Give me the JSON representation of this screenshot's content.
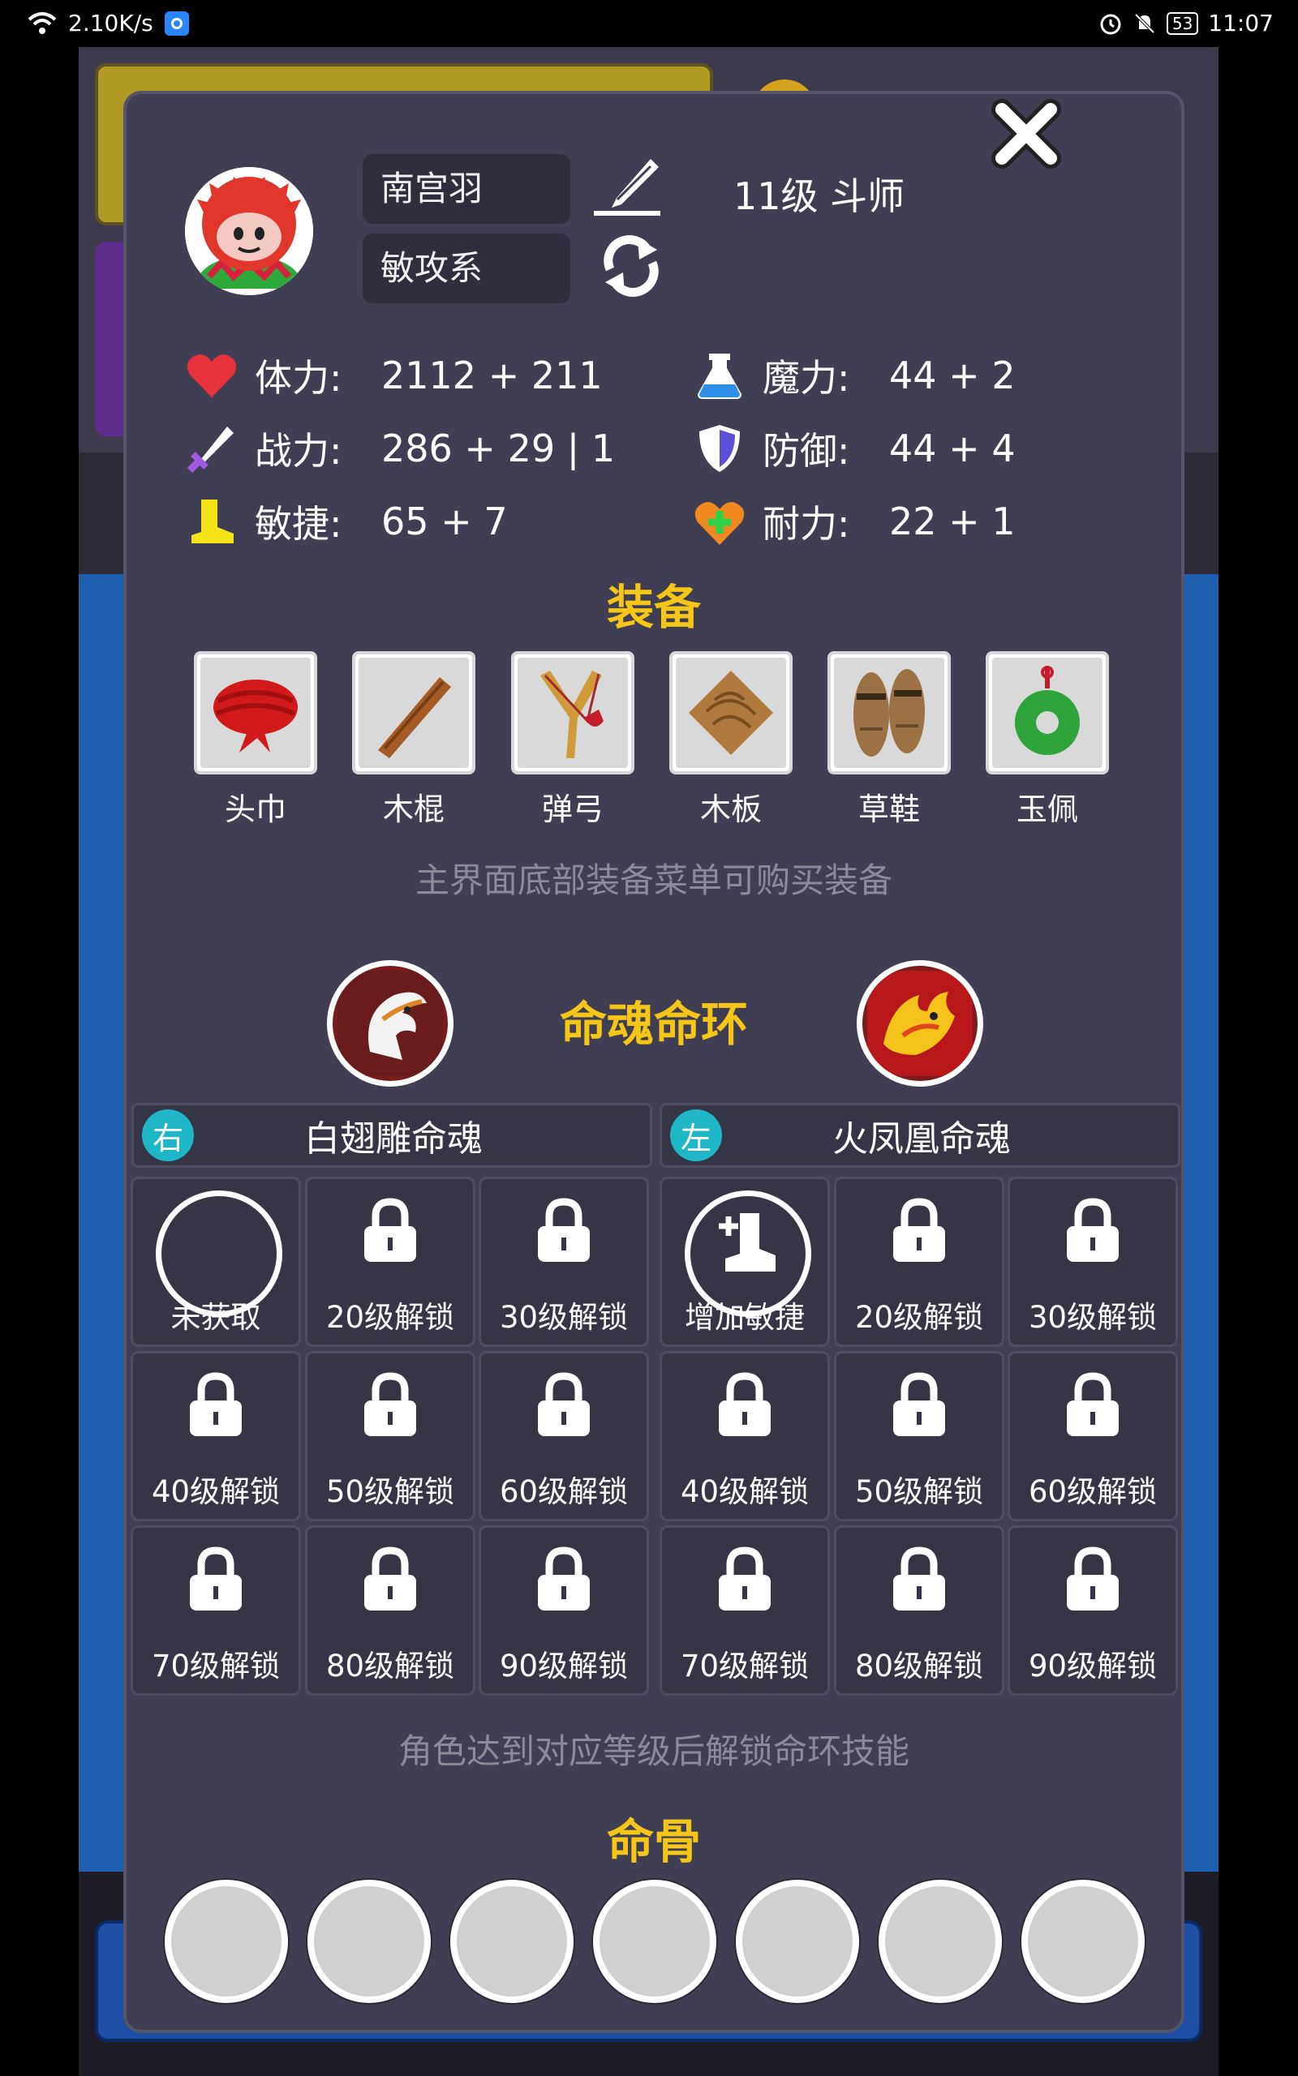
{
  "status_bar": {
    "net_speed": "2.10K/s",
    "battery": "53",
    "time": "11:07"
  },
  "profile": {
    "name": "南宫羽",
    "school": "敏攻系",
    "level_title": "11级 斗师"
  },
  "stats": [
    {
      "icon": "heart-icon",
      "label": "体力:",
      "value": "2112 + 211"
    },
    {
      "icon": "potion-icon",
      "label": "魔力:",
      "value": "44 + 2"
    },
    {
      "icon": "sword-icon",
      "label": "战力:",
      "value": "286 + 29 | 1"
    },
    {
      "icon": "shield-icon",
      "label": "防御:",
      "value": "44 + 4"
    },
    {
      "icon": "boot-icon",
      "label": "敏捷:",
      "value": "65 + 7"
    },
    {
      "icon": "heart-plus-icon",
      "label": "耐力:",
      "value": "22 + 1"
    }
  ],
  "equipment": {
    "title": "装备",
    "items": [
      "头巾",
      "木棍",
      "弹弓",
      "木板",
      "草鞋",
      "玉佩"
    ],
    "hint": "主界面底部装备菜单可购买装备"
  },
  "soul_ring": {
    "title": "命魂命环",
    "right": {
      "tag": "右",
      "name": "白翅雕命魂"
    },
    "left": {
      "tag": "左",
      "name": "火凤凰命魂"
    },
    "right_cells": [
      "未获取",
      "20级解锁",
      "30级解锁",
      "40级解锁",
      "50级解锁",
      "60级解锁",
      "70级解锁",
      "80级解锁",
      "90级解锁"
    ],
    "left_cells": [
      "增加敏捷",
      "20级解锁",
      "30级解锁",
      "40级解锁",
      "50级解锁",
      "60级解锁",
      "70级解锁",
      "80级解锁",
      "90级解锁"
    ],
    "hint": "角色达到对应等级后解锁命环技能"
  },
  "bones": {
    "title": "命骨",
    "slots": 7
  },
  "colors": {
    "accent": "#f5c518",
    "panel": "#3f3e52",
    "tag": "#1fb7c7"
  }
}
